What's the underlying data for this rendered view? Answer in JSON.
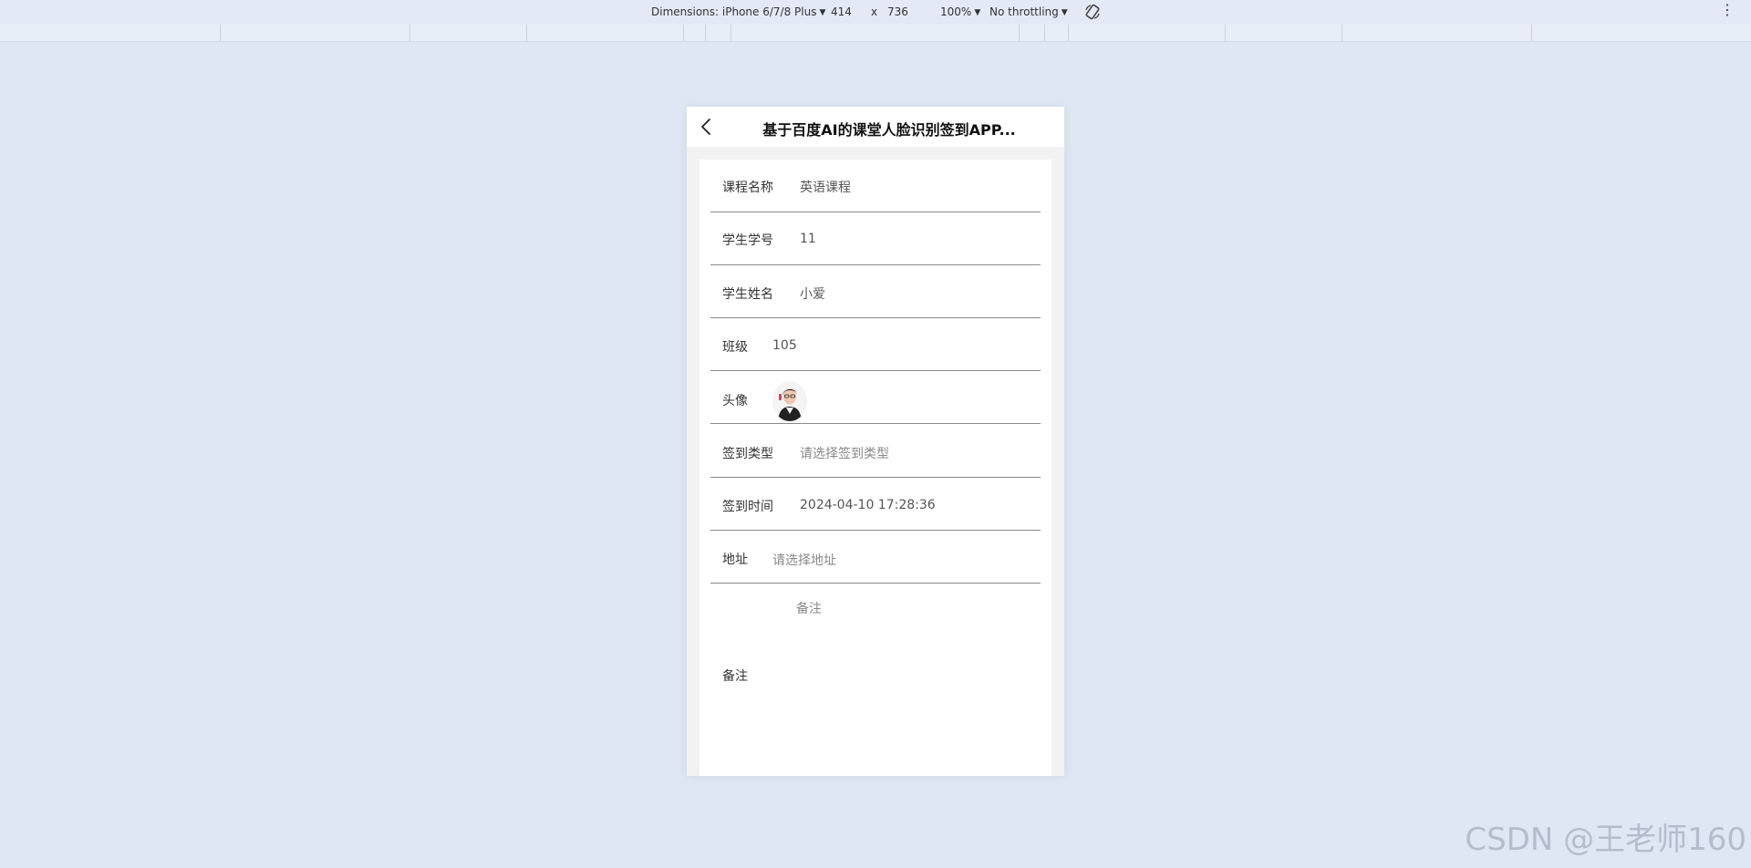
{
  "devtools": {
    "dimensions_label": "Dimensions: iPhone 6/7/8 Plus",
    "width_value": "414",
    "times": "x",
    "height_value": "736",
    "zoom": "100%",
    "throttling": "No throttling",
    "more": "⋮"
  },
  "nav": {
    "title": "基于百度AI的课堂人脸识别签到APP..."
  },
  "form": {
    "course": {
      "label": "课程名称",
      "value": "英语课程"
    },
    "student_id": {
      "label": "学生学号",
      "value": "11"
    },
    "student_name": {
      "label": "学生姓名",
      "value": "小爱"
    },
    "class": {
      "label": "班级",
      "value": "105"
    },
    "avatar": {
      "label": "头像"
    },
    "checkin_type": {
      "label": "签到类型",
      "placeholder": "请选择签到类型"
    },
    "checkin_time": {
      "label": "签到时间",
      "value": "2024-04-10 17:28:36"
    },
    "address": {
      "label": "地址",
      "placeholder": "请选择地址"
    },
    "remark": {
      "label": "备注",
      "placeholder": "备注"
    }
  },
  "watermark": "CSDN @王老师160"
}
